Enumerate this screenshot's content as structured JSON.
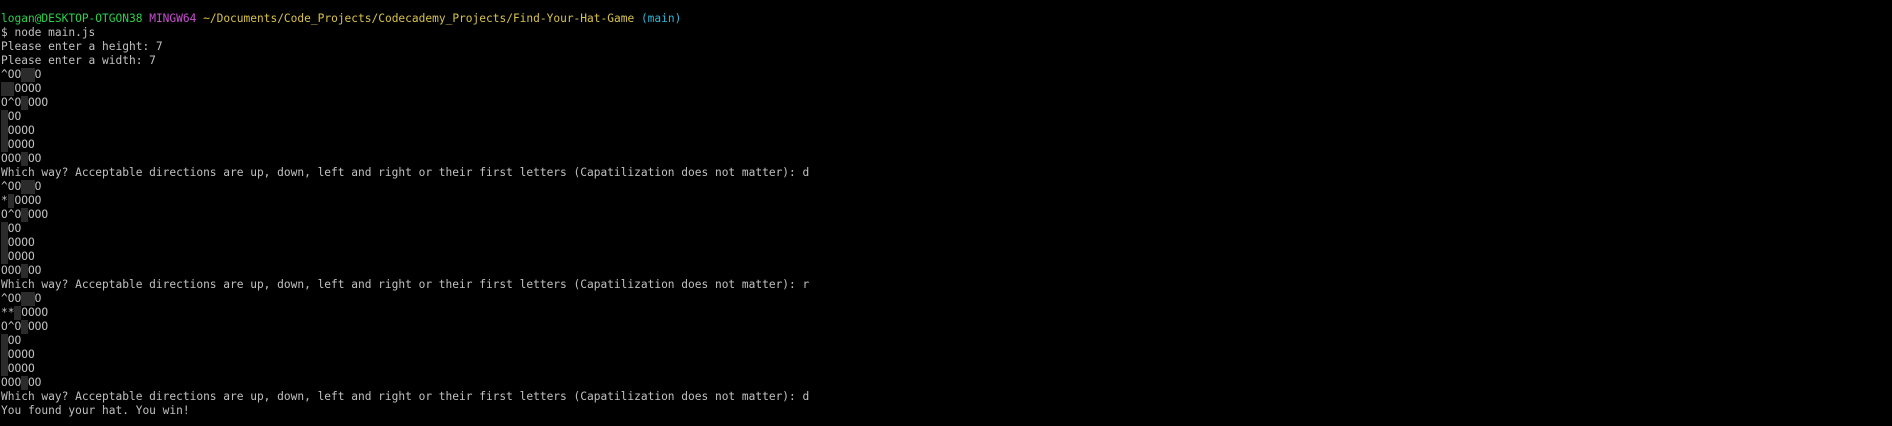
{
  "prompt": {
    "user_host": "logan@DESKTOP-OTGON38",
    "system": "MINGW64",
    "path": "~/Documents/Code_Projects/Codecademy_Projects/Find-Your-Hat-Game",
    "branch": "(main)"
  },
  "command_line": "$ node main.js",
  "height_prompt": "Please enter a height: 7",
  "width_prompt": "Please enter a width: 7",
  "boards": [
    {
      "rows": [
        "^OO  O",
        "  OOOO",
        "O^O OOO",
        " OO",
        " OOOO",
        " OOOO",
        "OOO OO"
      ]
    },
    {
      "rows": [
        "^OO  O",
        "* OOOO",
        "O^O OOO",
        " OO",
        " OOOO",
        " OOOO",
        "OOO OO"
      ]
    },
    {
      "rows": [
        "^OO  O",
        "** OOOO",
        "O^O OOO",
        " OO",
        " OOOO",
        " OOOO",
        "OOO OO"
      ]
    }
  ],
  "direction_prompts": [
    "Which way? Acceptable directions are up, down, left and right or their first letters (Capatilization does not matter): d",
    "Which way? Acceptable directions are up, down, left and right or their first letters (Capatilization does not matter): r",
    "Which way? Acceptable directions are up, down, left and right or their first letters (Capatilization does not matter): d"
  ],
  "result": "You found your hat. You win!",
  "colors": {
    "background": "#000000",
    "text": "#c0c0c0",
    "user_host": "#28d14a",
    "system": "#c94fd1",
    "path": "#d7c24a",
    "branch": "#2fb6d6",
    "field_cell": "#2b2b2b"
  }
}
